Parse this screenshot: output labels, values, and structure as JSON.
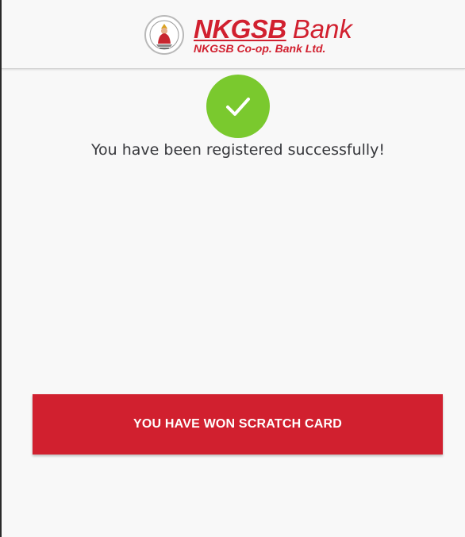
{
  "header": {
    "logo": {
      "brand_name": "NKGSB",
      "brand_suffix": "Bank",
      "subtitle": "NKGSB Co-op. Bank Ltd.",
      "emblem_icon": "deity-emblem-icon"
    }
  },
  "status": {
    "icon": "checkmark-icon",
    "message": "You have been registered successfully!"
  },
  "actions": {
    "scratch_card_label": "YOU HAVE WON SCRATCH CARD"
  },
  "colors": {
    "brand_red": "#d1202f",
    "success_green": "#7ac92e",
    "background": "#f8f8f8",
    "text": "#37383c"
  }
}
